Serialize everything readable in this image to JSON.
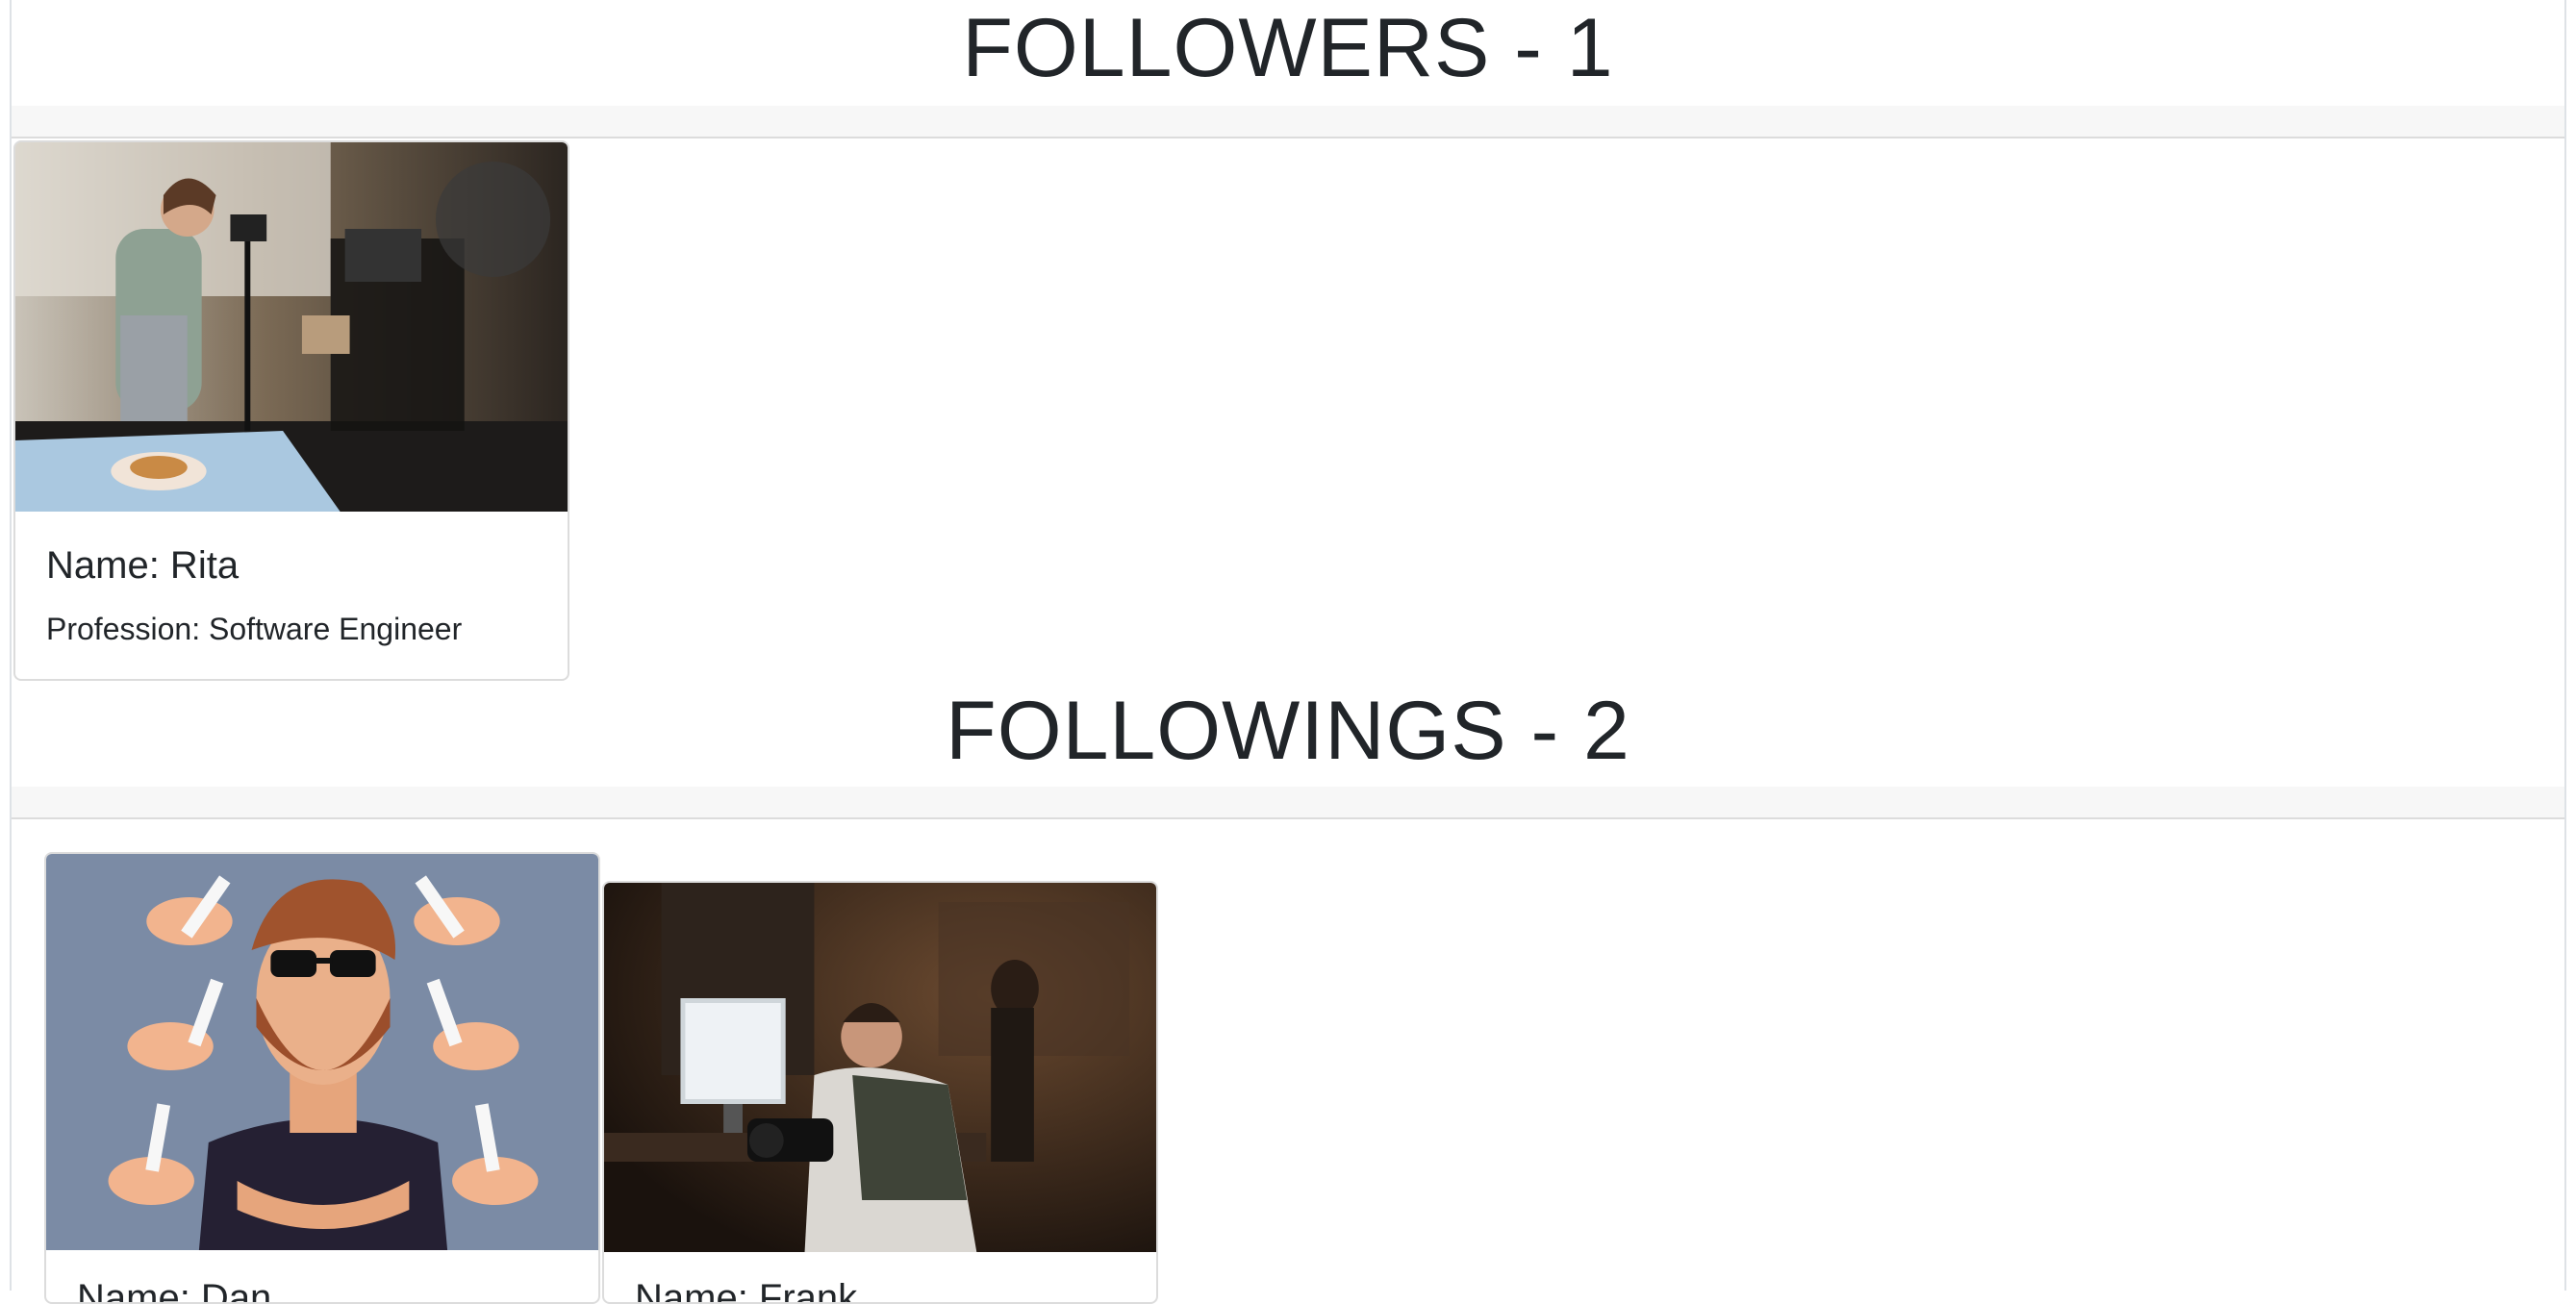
{
  "followers": {
    "title": "FOLLOWERS - 1",
    "cards": [
      {
        "name": "Name: Rita",
        "profession": "Profession: Software Engineer",
        "image_icon": "photographer-kitchen-photo"
      }
    ]
  },
  "followings": {
    "title": "FOLLOWINGS - 2",
    "cards": [
      {
        "name": "Name: Dan",
        "image_icon": "bearded-man-cartoon-photo"
      },
      {
        "name": "Name: Frank",
        "image_icon": "photographer-editing-photo"
      }
    ]
  }
}
